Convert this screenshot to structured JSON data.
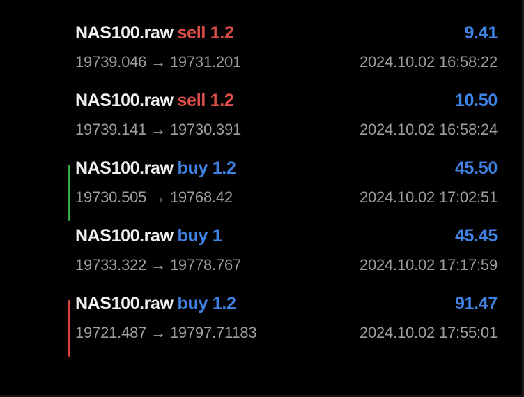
{
  "colors": {
    "background": "#000000",
    "symbol": "#f2f2f2",
    "sell": "#e0504a",
    "buy": "#3f82e4",
    "profit": "#3f82e4",
    "secondary_text": "#9d9d9d",
    "marker_green": "#2fae3e",
    "marker_red": "#d8443d"
  },
  "deals": [
    {
      "symbol": "NAS100.raw",
      "side": "sell 1.2",
      "type": "sell",
      "profit": "9.41",
      "prices": "19739.046 → 19731.201",
      "time": "2024.10.02 16:58:22",
      "marker": "none"
    },
    {
      "symbol": "NAS100.raw",
      "side": "sell 1.2",
      "type": "sell",
      "profit": "10.50",
      "prices": "19739.141 → 19730.391",
      "time": "2024.10.02 16:58:24",
      "marker": "none"
    },
    {
      "symbol": "NAS100.raw",
      "side": "buy 1.2",
      "type": "buy",
      "profit": "45.50",
      "prices": "19730.505 → 19768.42",
      "time": "2024.10.02 17:02:51",
      "marker": "green"
    },
    {
      "symbol": "NAS100.raw",
      "side": "buy 1",
      "type": "buy",
      "profit": "45.45",
      "prices": "19733.322 → 19778.767",
      "time": "2024.10.02 17:17:59",
      "marker": "none"
    },
    {
      "symbol": "NAS100.raw",
      "side": "buy 1.2",
      "type": "buy",
      "profit": "91.47",
      "prices": "19721.487 → 19797.71183",
      "time": "2024.10.02 17:55:01",
      "marker": "red"
    }
  ]
}
